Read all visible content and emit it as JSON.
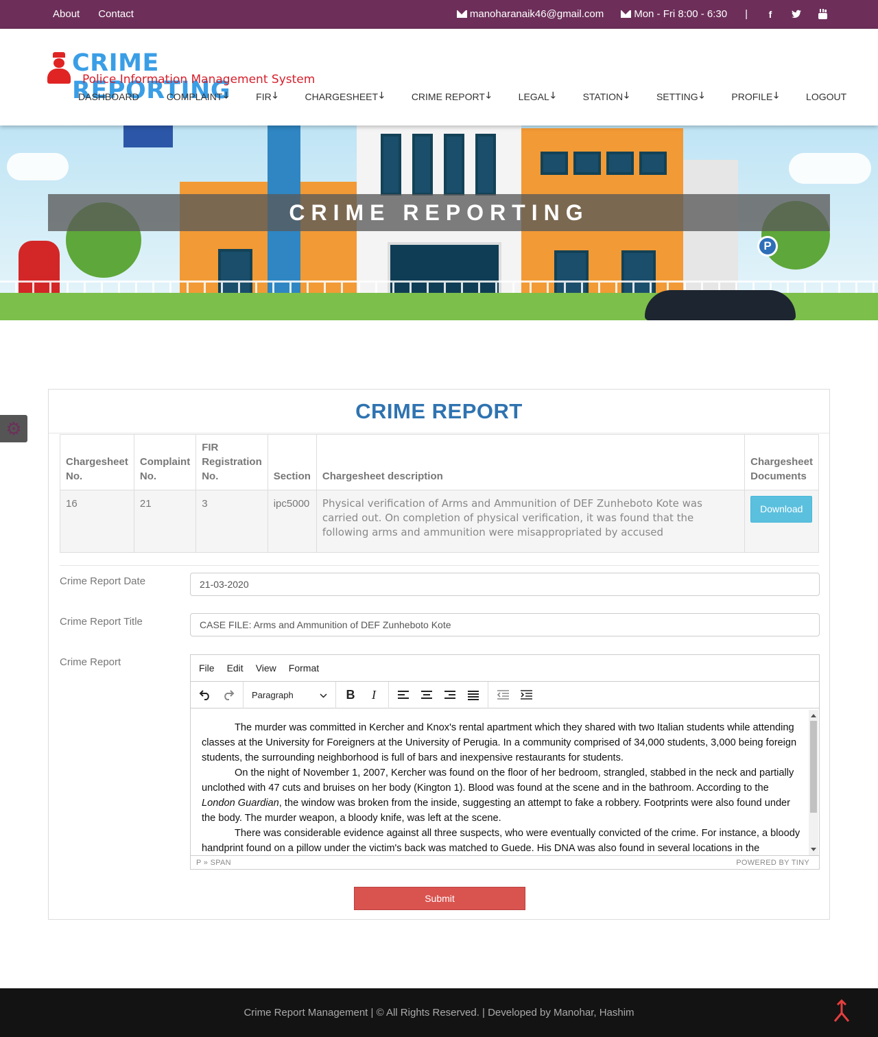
{
  "topbar": {
    "links": [
      "About",
      "Contact"
    ],
    "email": "manoharanaik46@gmail.com",
    "hours": "Mon - Fri 8:00 - 6:30",
    "separator": "|",
    "social": [
      "facebook-icon",
      "twitter-icon",
      "youtube-icon"
    ]
  },
  "logo": {
    "title": "CRIME REPORTING",
    "subtitle": "Police Information Management System"
  },
  "nav": {
    "items": [
      {
        "label": "DASHBOARD",
        "dropdown": false
      },
      {
        "label": "COMPLAINT",
        "dropdown": true
      },
      {
        "label": "FIR",
        "dropdown": true
      },
      {
        "label": "CHARGESHEET",
        "dropdown": true
      },
      {
        "label": "CRIME REPORT",
        "dropdown": true
      },
      {
        "label": "LEGAL",
        "dropdown": true
      },
      {
        "label": "STATION",
        "dropdown": true
      },
      {
        "label": "SETTING",
        "dropdown": true
      },
      {
        "label": "PROFILE",
        "dropdown": true
      },
      {
        "label": "LOGOUT",
        "dropdown": false
      }
    ],
    "arrow": "🡓"
  },
  "banner": {
    "heading": "CRIME REPORTING",
    "parking_sign": "P"
  },
  "panel": {
    "title": "CRIME REPORT",
    "table": {
      "headers": [
        "Chargesheet No.",
        "Complaint No.",
        "FIR Registration No.",
        "Section",
        "Chargesheet description",
        "Chargesheet Documents"
      ],
      "rows": [
        {
          "chargesheet_no": "16",
          "complaint_no": "21",
          "fir_no": "3",
          "section": "ipc5000",
          "description": "Physical verification of Arms and Ammunition of DEF Zunheboto Kote was carried out. On completion of physical verification, it was found that the following arms and ammunition were misappropriated by accused",
          "document_button": "Download"
        }
      ]
    },
    "form": {
      "date_label": "Crime Report Date",
      "date_value": "21-03-2020",
      "title_label": "Crime Report Title",
      "title_value": "CASE FILE: Arms and Ammunition of DEF Zunheboto Kote",
      "report_label": "Crime Report"
    },
    "editor": {
      "menu": [
        "File",
        "Edit",
        "View",
        "Format"
      ],
      "block_format": "Paragraph",
      "paragraphs": [
        "The murder was committed in Kercher and Knox's rental apartment which they shared with two Italian students while attending classes at the University for Foreigners at the University of Perugia. In a community comprised of 34,000 students, 3,000 being foreign students, the surrounding neighborhood is full of bars and inexpensive restaurants for students.",
        "On the night of November 1, 2007, Kercher was found on the floor of her bedroom, strangled, stabbed in the neck and partially unclothed with 47 cuts and bruises on her body (Kington 1). Blood was found at the scene and in the bathroom. According to the",
        "London Guardian",
        ", the window was broken from the inside, suggesting an attempt to fake a robbery. Footprints were also found under the body. The murder weapon, a bloody knife, was left at the scene.",
        "There was considerable evidence against all three suspects, who were eventually convicted of the crime.  For instance, a bloody handprint found on a pillow under the victim's back was matched to Guede. His DNA was also found in several locations in the"
      ],
      "status_path": "P » SPAN",
      "powered_by": "POWERED BY TINY"
    },
    "submit_label": "Submit"
  },
  "footer": {
    "text": "Crime Report Management | © All Rights Reserved. | Developed by Manohar, Hashim"
  },
  "colors": {
    "topbar": "#6d2f5a",
    "title_blue": "#2f73b0",
    "download": "#5bc0de",
    "submit": "#d9534f",
    "footer": "#131313"
  }
}
